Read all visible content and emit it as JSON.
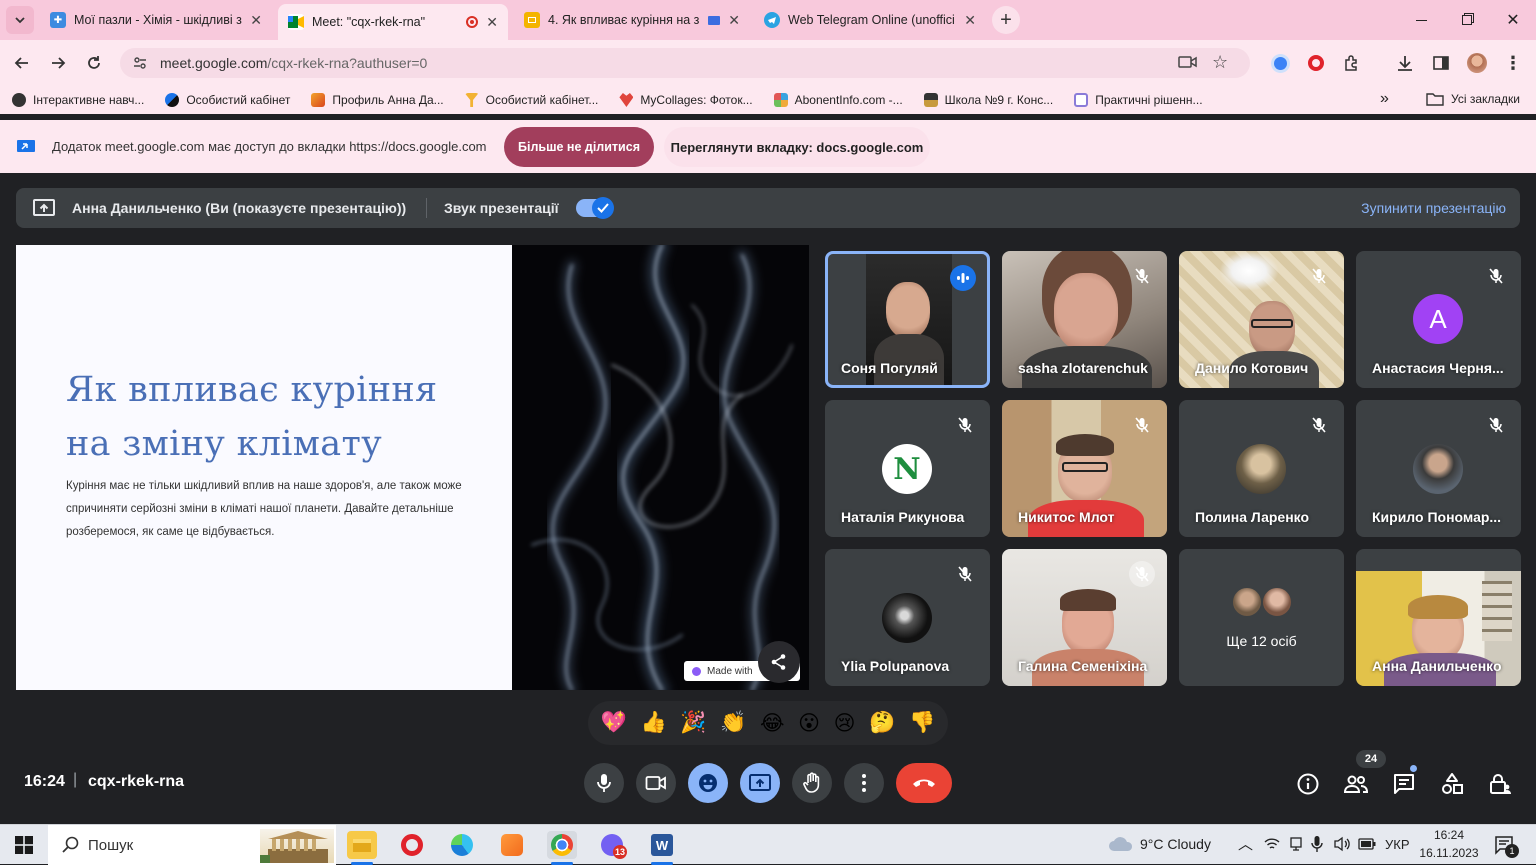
{
  "browser": {
    "tabs": [
      {
        "title": "Мої пазли - Хімія - шкідливі з",
        "active": false
      },
      {
        "title": "Meet: \"cqx-rkek-rna\"",
        "active": true
      },
      {
        "title": "4. Як впливає куріння на з",
        "active": false
      },
      {
        "title": "Web Telegram Online (unoffici",
        "active": false
      }
    ],
    "new_tab": "+",
    "url_host": "meet.google.com",
    "url_path": "/cqx-rkek-rna?authuser=0",
    "bookmarks": [
      "Інтерактивне навч...",
      "Особистий кабінет",
      "Профиль Анна Да...",
      "Особистий кабінет...",
      "MyCollages: Фоток...",
      "AbonentInfo.com -...",
      "Школа №9 г. Конс...",
      "Практичні рішенн..."
    ],
    "more_bookmarks": "»",
    "all_bookmarks": "Усі закладки"
  },
  "infobar": {
    "message": "Додаток meet.google.com має доступ до вкладки https://docs.google.com",
    "stop_sharing": "Більше не ділитися",
    "view_tab": "Переглянути вкладку: docs.google.com"
  },
  "meet": {
    "presenter_label": "Анна Данильченко (Ви (показуєте презентацію))",
    "presentation_audio": "Звук презентації",
    "stop_presenting": "Зупинити презентацію",
    "slide": {
      "title": "Як впливає куріння на зміну клімату",
      "body": "Куріння має не тільки шкідливий вплив на наше здоров'я, але також може спричиняти серйозні зміни в кліматі нашої планети. Давайте детальніше розберемося, як саме це відбувається.",
      "made_with": "Made with"
    },
    "participants": [
      {
        "name": "Соня Погуляй",
        "speaking": true
      },
      {
        "name": "sasha zlotarenchuk"
      },
      {
        "name": "Данило Котович"
      },
      {
        "name": "Анастасия Черня...",
        "initial": "A"
      },
      {
        "name": "Наталія Рикунова",
        "initial": "N"
      },
      {
        "name": "Никитос Млот"
      },
      {
        "name": "Полина Ларенко"
      },
      {
        "name": "Кирило Пономар..."
      },
      {
        "name": "Ylia Polupanova"
      },
      {
        "name": "Галина Семеніхіна"
      },
      {
        "name": "Ще 12 осіб"
      },
      {
        "name": "Анна Данильченко"
      }
    ],
    "reactions": [
      "💖",
      "👍",
      "🎉",
      "👏",
      "😂",
      "😮",
      "😢",
      "🤔",
      "👎"
    ],
    "time": "16:24",
    "separator": "|",
    "meeting_code": "cqx-rkek-rna",
    "people_count": "24"
  },
  "taskbar": {
    "search_placeholder": "Пошук",
    "weather": "9°C  Cloudy",
    "language": "УКР",
    "time": "16:24",
    "date": "16.11.2023",
    "viber_badge": "13",
    "notif_badge": "1"
  },
  "colors": {
    "accent_blue": "#8ab4f8",
    "end_call_red": "#ea4335",
    "slide_title": "#4a6fb6",
    "tab_strip": "#f8c9dc"
  }
}
